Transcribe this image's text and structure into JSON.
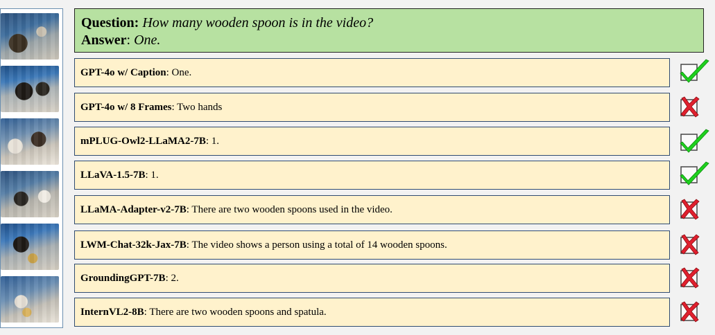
{
  "qa": {
    "question_label": "Question:",
    "question_text": "How many wooden spoon is in the video?",
    "answer_label": "Answer",
    "answer_sep": ":",
    "answer_text": "One."
  },
  "frames": [
    {
      "name": "frame-1"
    },
    {
      "name": "frame-2"
    },
    {
      "name": "frame-3"
    },
    {
      "name": "frame-4"
    },
    {
      "name": "frame-5"
    },
    {
      "name": "frame-6"
    }
  ],
  "responses": [
    {
      "model": "GPT-4o w/ Caption",
      "text": ": One.",
      "result": "correct"
    },
    {
      "model": "GPT-4o w/ 8 Frames",
      "text": ": Two hands",
      "result": "wrong"
    },
    {
      "model": "mPLUG-Owl2-LLaMA2-7B",
      "text": ": 1.",
      "result": "correct"
    },
    {
      "model": "LLaVA-1.5-7B",
      "text": ": 1.",
      "result": "correct"
    },
    {
      "model": "LLaMA-Adapter-v2-7B",
      "text": ": There are two wooden spoons used in the video.",
      "result": "wrong"
    },
    {
      "model": "LWM-Chat-32k-Jax-7B",
      "text": ": The video shows a person using a total of 14 wooden spoons.",
      "result": "wrong"
    },
    {
      "model": "GroundingGPT-7B",
      "text": ": 2.",
      "result": "wrong"
    },
    {
      "model": "InternVL2-8B",
      "text": ": There are two wooden spoons and spatula.",
      "result": "wrong"
    }
  ],
  "colors": {
    "question_bg": "#b7e1a1",
    "response_bg": "#fff2cc",
    "check": "#1fd11f",
    "cross": "#e0202e"
  }
}
